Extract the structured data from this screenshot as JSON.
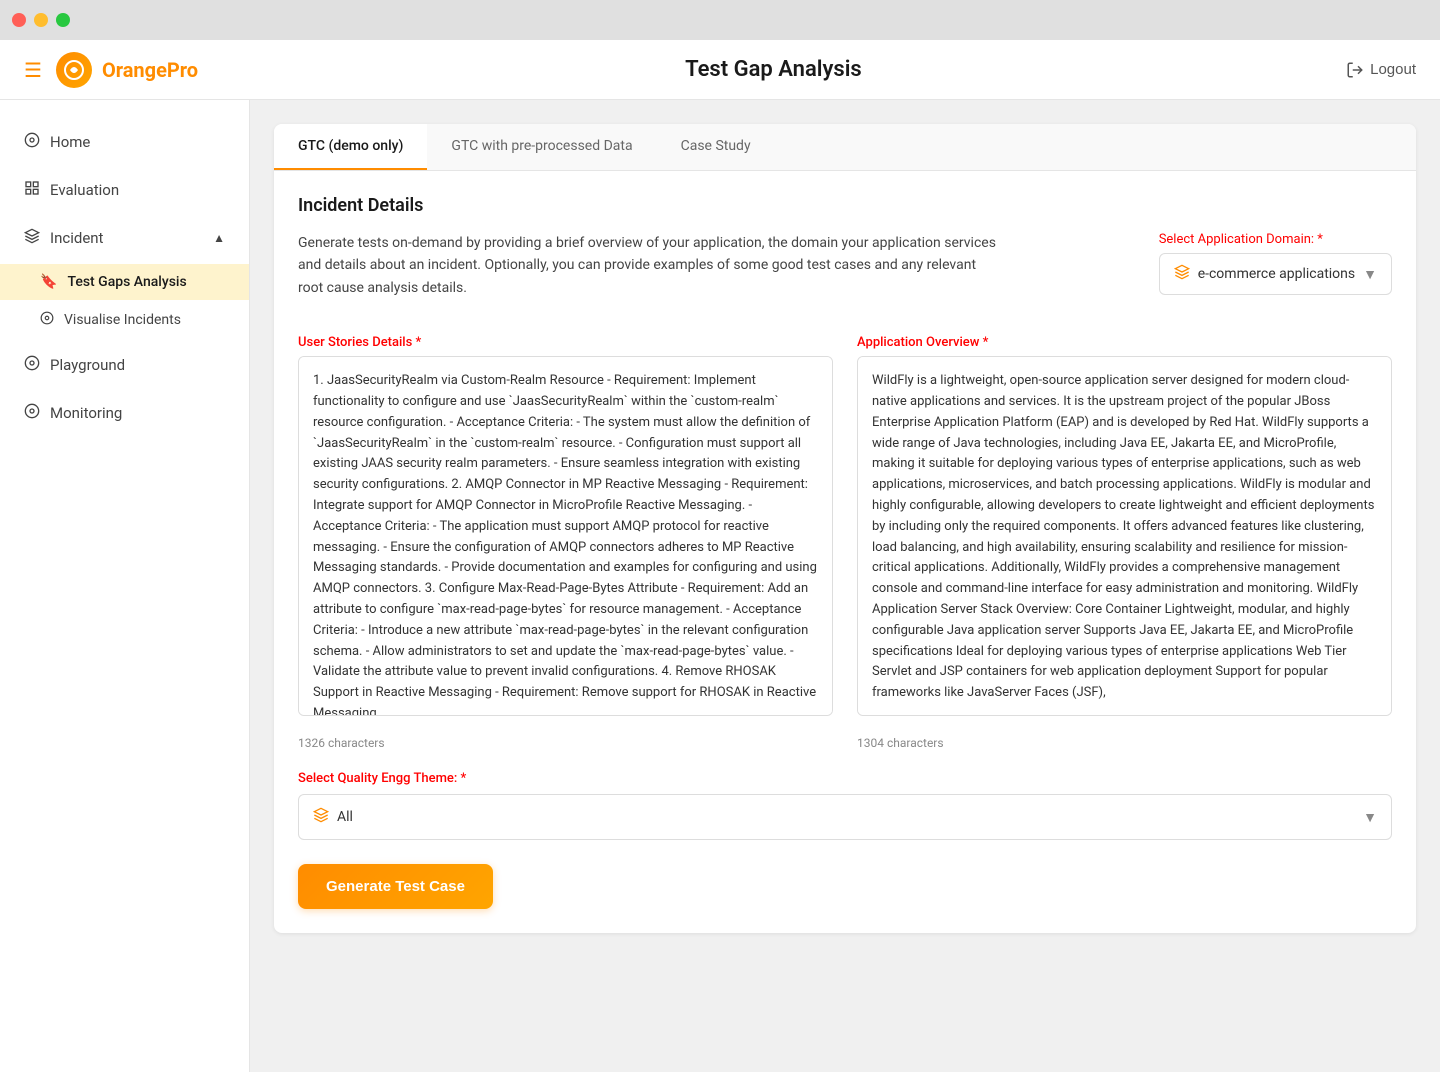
{
  "titlebar": {
    "close": "close",
    "minimize": "minimize",
    "maximize": "maximize"
  },
  "topnav": {
    "logo_text": "OrangePro",
    "page_title": "Test Gap Analysis",
    "logout_label": "Logout"
  },
  "sidebar": {
    "items": [
      {
        "id": "home",
        "label": "Home",
        "icon": "⊙"
      },
      {
        "id": "evaluation",
        "label": "Evaluation",
        "icon": "⊞"
      },
      {
        "id": "incident",
        "label": "Incident",
        "icon": "◈",
        "has_children": true,
        "expanded": true,
        "children": [
          {
            "id": "test-gaps-analysis",
            "label": "Test Gaps Analysis",
            "icon": "🔖",
            "active": true
          },
          {
            "id": "visualise-incidents",
            "label": "Visualise Incidents",
            "icon": "⊙"
          }
        ]
      },
      {
        "id": "playground",
        "label": "Playground",
        "icon": "⊙"
      },
      {
        "id": "monitoring",
        "label": "Monitoring",
        "icon": "⊙"
      }
    ]
  },
  "tabs": [
    {
      "id": "gtc-demo",
      "label": "GTC (demo only)",
      "active": true
    },
    {
      "id": "gtc-preprocessed",
      "label": "GTC with pre-processed Data",
      "active": false
    },
    {
      "id": "case-study",
      "label": "Case Study",
      "active": false
    }
  ],
  "incident_details": {
    "section_title": "Incident Details",
    "description": "Generate tests on-demand by providing a brief overview of your application, the domain your application services and details about an incident. Optionally, you can provide examples of some good test cases and any relevant root cause analysis details.",
    "domain_label": "Select Application Domain:",
    "domain_required": "*",
    "domain_value": "e-commerce applications",
    "user_stories_label": "User Stories Details",
    "user_stories_required": "*",
    "user_stories_value": "1. JaasSecurityRealm via Custom-Realm Resource - Requirement: Implement functionality to configure and use `JaasSecurityRealm` within the `custom-realm` resource configuration. - Acceptance Criteria: - The system must allow the definition of `JaasSecurityRealm` in the `custom-realm` resource. - Configuration must support all existing JAAS security realm parameters. - Ensure seamless integration with existing security configurations. 2. AMQP Connector in MP Reactive Messaging - Requirement: Integrate support for AMQP Connector in MicroProfile Reactive Messaging. - Acceptance Criteria: - The application must support AMQP protocol for reactive messaging. - Ensure the configuration of AMQP connectors adheres to MP Reactive Messaging standards. - Provide documentation and examples for configuring and using AMQP connectors. 3. Configure Max-Read-Page-Bytes Attribute - Requirement: Add an attribute to configure `max-read-page-bytes` for resource management. - Acceptance Criteria: - Introduce a new attribute `max-read-page-bytes` in the relevant configuration schema. - Allow administrators to set and update the `max-read-page-bytes` value. - Validate the attribute value to prevent invalid configurations. 4. Remove RHOSAK Support in Reactive Messaging - Requirement: Remove support for RHOSAK in Reactive Messaging.",
    "user_stories_chars": "1326 characters",
    "app_overview_label": "Application Overview",
    "app_overview_required": "*",
    "app_overview_value": "WildFly is a lightweight, open-source application server designed for modern cloud-native applications and services. It is the upstream project of the popular JBoss Enterprise Application Platform (EAP) and is developed by Red Hat. WildFly supports a wide range of Java technologies, including Java EE, Jakarta EE, and MicroProfile, making it suitable for deploying various types of enterprise applications, such as web applications, microservices, and batch processing applications. WildFly is modular and highly configurable, allowing developers to create lightweight and efficient deployments by including only the required components. It offers advanced features like clustering, load balancing, and high availability, ensuring scalability and resilience for mission-critical applications. Additionally, WildFly provides a comprehensive management console and command-line interface for easy administration and monitoring. WildFly Application Server Stack Overview: Core Container Lightweight, modular, and highly configurable Java application server Supports Java EE, Jakarta EE, and MicroProfile specifications Ideal for deploying various types of enterprise applications Web Tier Servlet and JSP containers for web application deployment Support for popular frameworks like JavaServer Faces (JSF),",
    "app_overview_chars": "1304 characters",
    "quality_label": "Select Quality Engg Theme:",
    "quality_required": "*",
    "quality_value": "All",
    "generate_btn_label": "Generate Test Case"
  }
}
